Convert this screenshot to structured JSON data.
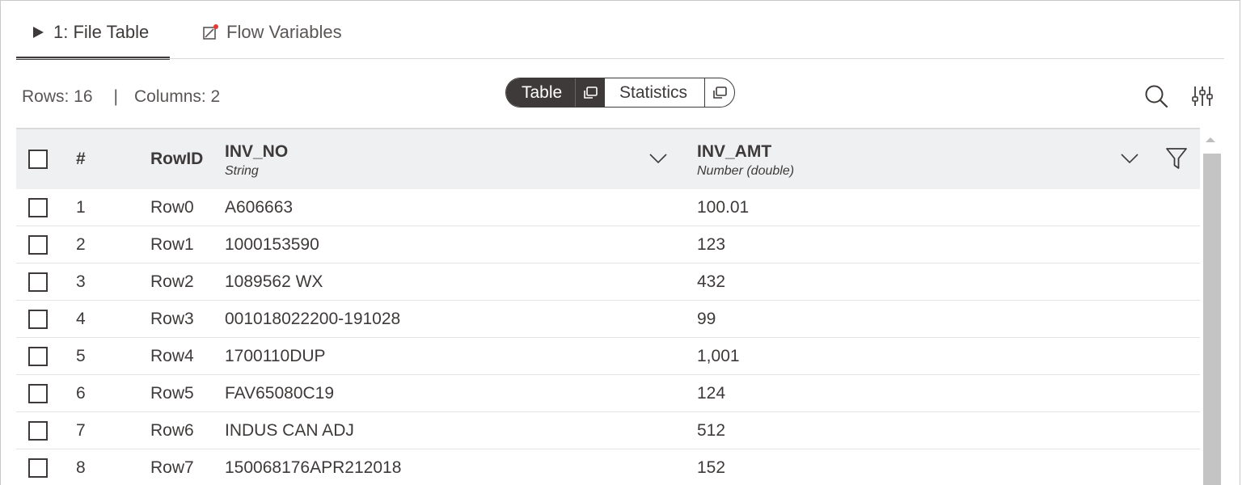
{
  "tabs": [
    {
      "label": "1: File Table",
      "icon": "play-triangle-icon",
      "active": true
    },
    {
      "label": "Flow Variables",
      "icon": "flow-variable-icon",
      "active": false
    }
  ],
  "info": {
    "rows_label": "Rows: 16",
    "separator": "|",
    "columns_label": "Columns: 2"
  },
  "view_toggle": {
    "table_label": "Table",
    "statistics_label": "Statistics",
    "selected": "Table"
  },
  "table": {
    "header": {
      "num": "#",
      "rowid": "RowID",
      "col1_name": "INV_NO",
      "col1_type": "String",
      "col2_name": "INV_AMT",
      "col2_type": "Number (double)"
    },
    "rows": [
      {
        "num": "1",
        "rowid": "Row0",
        "inv_no": "A606663",
        "inv_amt": "100.01"
      },
      {
        "num": "2",
        "rowid": "Row1",
        "inv_no": "1000153590",
        "inv_amt": "123"
      },
      {
        "num": "3",
        "rowid": "Row2",
        "inv_no": "1089562 WX",
        "inv_amt": "432"
      },
      {
        "num": "4",
        "rowid": "Row3",
        "inv_no": "001018022200-191028",
        "inv_amt": "99"
      },
      {
        "num": "5",
        "rowid": "Row4",
        "inv_no": "1700110DUP",
        "inv_amt": "1,001"
      },
      {
        "num": "6",
        "rowid": "Row5",
        "inv_no": "FAV65080C19",
        "inv_amt": "124"
      },
      {
        "num": "7",
        "rowid": "Row6",
        "inv_no": "INDUS CAN ADJ",
        "inv_amt": "512"
      },
      {
        "num": "8",
        "rowid": "Row7",
        "inv_no": "150068176APR212018",
        "inv_amt": "152"
      }
    ]
  },
  "colors": {
    "text": "#3e3a39",
    "header_bg": "#eef0f2",
    "accent_dot": "#e53935",
    "scrollbar": "#c4c4c4"
  }
}
